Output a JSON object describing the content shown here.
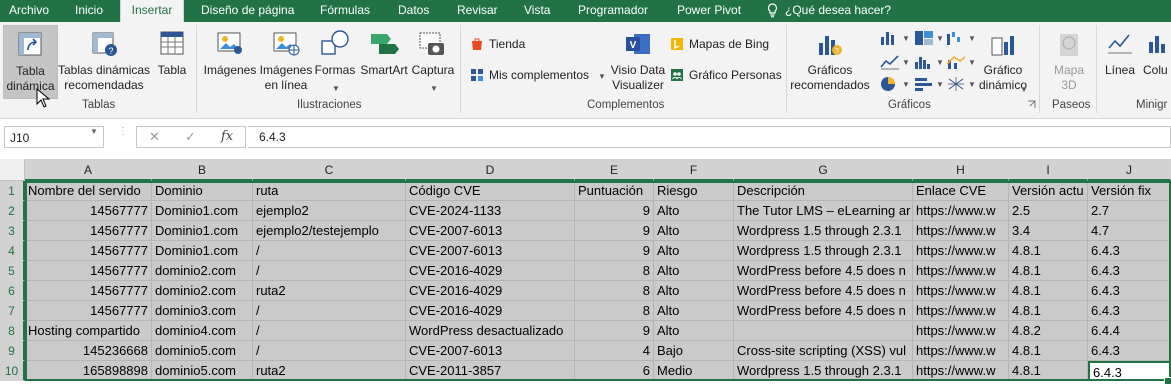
{
  "tabs": [
    "Archivo",
    "Inicio",
    "Insertar",
    "Diseño de página",
    "Fórmulas",
    "Datos",
    "Revisar",
    "Vista",
    "Programador",
    "Power Pivot"
  ],
  "tell_me": "¿Qué desea hacer?",
  "ribbon": {
    "tablas": {
      "pivot": [
        "Tabla",
        "dinámica"
      ],
      "recommended_pivot": [
        "Tablas dinámicas",
        "recomendadas"
      ],
      "table": "Tabla",
      "group": "Tablas"
    },
    "ilustraciones": {
      "images": "Imágenes",
      "online_images": [
        "Imágenes",
        "en línea"
      ],
      "shapes": "Formas",
      "smartart": "SmartArt",
      "screenshot": "Captura",
      "group": "Ilustraciones"
    },
    "complementos": {
      "store": "Tienda",
      "my_addins": "Mis complementos",
      "visio": [
        "Visio Data",
        "Visualizer"
      ],
      "bing_maps": "Mapas de Bing",
      "people_graph": "Gráfico Personas",
      "group": "Complementos"
    },
    "graficos": {
      "recommended": [
        "Gráficos",
        "recomendados"
      ],
      "pivot_chart": [
        "Gráfico",
        "dinámico"
      ],
      "group": "Gráficos"
    },
    "paseos": {
      "map3d": [
        "Mapa",
        "3D"
      ],
      "group": "Paseos"
    },
    "minigraficos": {
      "line": "Línea",
      "column": "Colu",
      "group": "Minigr"
    }
  },
  "formula_bar": {
    "name_box": "J10",
    "cancel": "✕",
    "enter": "✓",
    "fx": "fx",
    "formula": "6.4.3"
  },
  "columns": [
    "A",
    "B",
    "C",
    "D",
    "E",
    "F",
    "G",
    "H",
    "I",
    "J"
  ],
  "rows": [
    [
      "Nombre del servido",
      "Dominio",
      "ruta",
      "Código CVE",
      "Puntuación",
      "Riesgo",
      "Descripción",
      "Enlace CVE",
      "Versión actu",
      "Versión fix"
    ],
    [
      "14567777",
      "Dominio1.com",
      "ejemplo2",
      "CVE-2024-1133",
      "9",
      "Alto",
      "The Tutor LMS – eLearning ar",
      "https://www.w",
      "2.5",
      "2.7"
    ],
    [
      "14567777",
      "Dominio1.com",
      "ejemplo2/testejemplo",
      "CVE-2007-6013",
      "9",
      "Alto",
      "Wordpress 1.5 through 2.3.1",
      "https://www.w",
      "3.4",
      "4.7"
    ],
    [
      "14567777",
      "Dominio1.com",
      "/",
      "CVE-2007-6013",
      "9",
      "Alto",
      "Wordpress 1.5 through 2.3.1",
      "https://www.w",
      "4.8.1",
      "6.4.3"
    ],
    [
      "14567777",
      "dominio2.com",
      "/",
      "CVE-2016-4029",
      "8",
      "Alto",
      "WordPress before 4.5 does n",
      "https://www.w",
      "4.8.1",
      "6.4.3"
    ],
    [
      "14567777",
      "dominio2.com",
      "ruta2",
      "CVE-2016-4029",
      "8",
      "Alto",
      "WordPress before 4.5 does n",
      "https://www.w",
      "4.8.1",
      "6.4.3"
    ],
    [
      "14567777",
      "dominio3.com",
      "/",
      "CVE-2016-4029",
      "8",
      "Alto",
      "WordPress before 4.5 does n",
      "https://www.w",
      "4.8.1",
      "6.4.3"
    ],
    [
      "Hosting compartido",
      "dominio4.com",
      "/",
      "WordPress desactualizado",
      "9",
      "Alto",
      "",
      "https://www.w",
      "4.8.2",
      "6.4.4"
    ],
    [
      "145236668",
      "dominio5.com",
      "/",
      "CVE-2007-6013",
      "4",
      "Bajo",
      "Cross-site scripting (XSS) vul",
      "https://www.w",
      "4.8.1",
      "6.4.3"
    ],
    [
      "165898898",
      "dominio5.com",
      "ruta2",
      "CVE-2011-3857",
      "6",
      "Medio",
      "Wordpress 1.5 through 2.3.1",
      "https://www.w",
      "4.8.1",
      "6.4.3"
    ]
  ],
  "colors": {
    "excel_green": "#217346",
    "selection_fill": "#cacaca"
  }
}
